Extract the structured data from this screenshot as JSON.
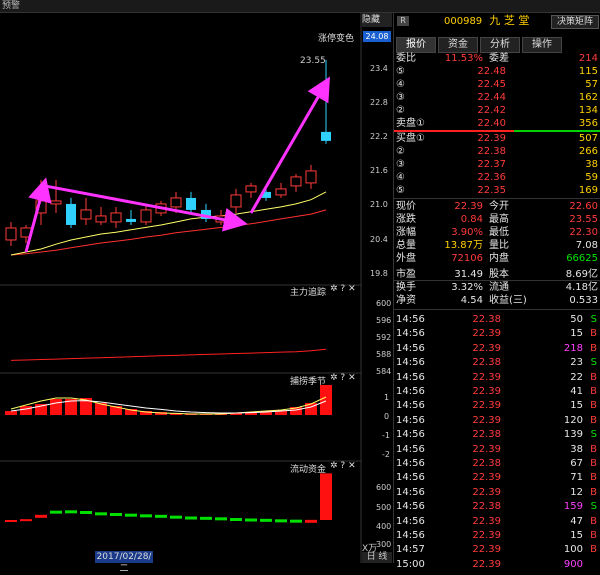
{
  "window": {
    "title": "预警"
  },
  "header": {
    "badge": "R",
    "code": "000989",
    "name": "九 芝 堂",
    "decision_button": "决策矩阵",
    "hide_button": "隐藏",
    "collapse_icon": "double-chevron-right-icon"
  },
  "tabs": [
    {
      "label": "报价",
      "active": true
    },
    {
      "label": "资金",
      "active": false
    },
    {
      "label": "分析",
      "active": false
    },
    {
      "label": "操作",
      "active": false
    }
  ],
  "main_chart": {
    "title": "涨停变色",
    "price_high_label": "23.55",
    "price_axis": [
      "24.08",
      "23.4",
      "22.8",
      "22.2",
      "21.6",
      "21.0",
      "20.4",
      "19.8"
    ],
    "current_marker": "24.08"
  },
  "indicators": [
    {
      "title": "主力追踪",
      "axis": [
        "600",
        "596",
        "592",
        "588",
        "584"
      ]
    },
    {
      "title": "捕捞季节",
      "axis": [
        "1",
        "0",
        "-1",
        "-2"
      ]
    },
    {
      "title": "流动资金",
      "axis": [
        "600",
        "500",
        "400",
        "300"
      ]
    }
  ],
  "footer": {
    "date_label": "2017/02/28/二",
    "unit_label": "X万",
    "period_label": "日 线"
  },
  "quote": {
    "ratio": {
      "label": "委比",
      "value": "11.53%",
      "label2": "委差",
      "value2": "214"
    },
    "asks": [
      {
        "label": "⑤",
        "price": "22.48",
        "vol": "115"
      },
      {
        "label": "④",
        "price": "22.45",
        "vol": "57"
      },
      {
        "label": "③",
        "price": "22.44",
        "vol": "162"
      },
      {
        "label": "②",
        "price": "22.42",
        "vol": "134"
      },
      {
        "label": "卖盘①",
        "price": "22.40",
        "vol": "356"
      }
    ],
    "bids": [
      {
        "label": "买盘①",
        "price": "22.39",
        "vol": "507"
      },
      {
        "label": "②",
        "price": "22.38",
        "vol": "266"
      },
      {
        "label": "③",
        "price": "22.37",
        "vol": "38"
      },
      {
        "label": "④",
        "price": "22.36",
        "vol": "59"
      },
      {
        "label": "⑤",
        "price": "22.35",
        "vol": "169"
      }
    ],
    "stats": [
      {
        "l1": "现价",
        "v1": "22.39",
        "c1": "red",
        "l2": "今开",
        "v2": "22.60",
        "c2": "red"
      },
      {
        "l1": "涨跌",
        "v1": "0.84",
        "c1": "red",
        "l2": "最高",
        "v2": "23.55",
        "c2": "red"
      },
      {
        "l1": "涨幅",
        "v1": "3.90%",
        "c1": "red",
        "l2": "最低",
        "v2": "22.30",
        "c2": "red"
      },
      {
        "l1": "总量",
        "v1": "13.87万",
        "c1": "yellow",
        "l2": "量比",
        "v2": "7.08",
        "c2": "white"
      },
      {
        "l1": "外盘",
        "v1": "72106",
        "c1": "red",
        "l2": "内盘",
        "v2": "66625",
        "c2": "green"
      },
      {
        "l1": "市盈",
        "v1": "31.49",
        "c1": "white",
        "l2": "股本",
        "v2": "8.69亿",
        "c2": "white"
      },
      {
        "l1": "换手",
        "v1": "3.32%",
        "c1": "white",
        "l2": "流通",
        "v2": "4.18亿",
        "c2": "white"
      },
      {
        "l1": "净资",
        "v1": "4.54",
        "c1": "white",
        "l2": "收益(三)",
        "v2": "0.533",
        "c2": "white"
      }
    ],
    "ticks": [
      {
        "time": "14:56",
        "price": "22.38",
        "vol": "50",
        "side": "S",
        "vc": "white"
      },
      {
        "time": "14:56",
        "price": "22.39",
        "vol": "15",
        "side": "B",
        "vc": "white"
      },
      {
        "time": "14:56",
        "price": "22.39",
        "vol": "218",
        "side": "B",
        "vc": "magenta"
      },
      {
        "time": "14:56",
        "price": "22.38",
        "vol": "23",
        "side": "S",
        "vc": "white"
      },
      {
        "time": "14:56",
        "price": "22.39",
        "vol": "22",
        "side": "B",
        "vc": "white"
      },
      {
        "time": "14:56",
        "price": "22.39",
        "vol": "41",
        "side": "B",
        "vc": "white"
      },
      {
        "time": "14:56",
        "price": "22.39",
        "vol": "15",
        "side": "B",
        "vc": "white"
      },
      {
        "time": "14:56",
        "price": "22.39",
        "vol": "120",
        "side": "B",
        "vc": "white"
      },
      {
        "time": "14:56",
        "price": "22.38",
        "vol": "139",
        "side": "S",
        "vc": "white"
      },
      {
        "time": "14:56",
        "price": "22.39",
        "vol": "38",
        "side": "B",
        "vc": "white"
      },
      {
        "time": "14:56",
        "price": "22.38",
        "vol": "67",
        "side": "B",
        "vc": "white"
      },
      {
        "time": "14:56",
        "price": "22.39",
        "vol": "71",
        "side": "B",
        "vc": "white"
      },
      {
        "time": "14:56",
        "price": "22.39",
        "vol": "12",
        "side": "B",
        "vc": "white"
      },
      {
        "time": "14:56",
        "price": "22.38",
        "vol": "159",
        "side": "S",
        "vc": "magenta"
      },
      {
        "time": "14:56",
        "price": "22.39",
        "vol": "47",
        "side": "B",
        "vc": "white"
      },
      {
        "time": "14:56",
        "price": "22.39",
        "vol": "15",
        "side": "B",
        "vc": "white"
      },
      {
        "time": "14:57",
        "price": "22.39",
        "vol": "100",
        "side": "B",
        "vc": "white"
      },
      {
        "time": "15:00",
        "price": "22.39",
        "vol": "900",
        "side": "",
        "vc": "magenta"
      }
    ]
  },
  "colors": {
    "up": "#ff3b3b",
    "down": "#30d0ff",
    "arrow": "#ff33ff",
    "ma1": "#ffff66",
    "ma2": "#ff3030"
  },
  "chart_data": [
    {
      "type": "candlestick",
      "title": "涨停变色",
      "ylim": [
        19.8,
        24.08
      ],
      "candles": [
        {
          "o": 20.55,
          "c": 20.75,
          "h": 20.85,
          "l": 20.45,
          "up": true
        },
        {
          "o": 20.6,
          "c": 20.75,
          "h": 20.8,
          "l": 20.5,
          "up": true
        },
        {
          "o": 21.0,
          "c": 21.2,
          "h": 21.55,
          "l": 20.8,
          "up": true
        },
        {
          "o": 21.2,
          "c": 21.15,
          "h": 21.55,
          "l": 21.0,
          "up": true
        },
        {
          "o": 21.15,
          "c": 20.8,
          "h": 21.25,
          "l": 20.75,
          "up": false
        },
        {
          "o": 20.9,
          "c": 21.05,
          "h": 21.25,
          "l": 20.8,
          "up": true
        },
        {
          "o": 20.95,
          "c": 20.85,
          "h": 21.1,
          "l": 20.8,
          "up": true
        },
        {
          "o": 20.85,
          "c": 21.0,
          "h": 21.1,
          "l": 20.75,
          "up": true
        },
        {
          "o": 20.9,
          "c": 20.85,
          "h": 21.05,
          "l": 20.8,
          "up": false
        },
        {
          "o": 20.85,
          "c": 21.05,
          "h": 21.15,
          "l": 20.8,
          "up": true
        },
        {
          "o": 21.0,
          "c": 21.15,
          "h": 21.2,
          "l": 20.95,
          "up": true
        },
        {
          "o": 21.25,
          "c": 21.1,
          "h": 21.35,
          "l": 21.0,
          "up": true
        },
        {
          "o": 21.25,
          "c": 21.05,
          "h": 21.35,
          "l": 21.0,
          "up": false
        },
        {
          "o": 21.05,
          "c": 20.9,
          "h": 21.15,
          "l": 20.85,
          "up": false
        },
        {
          "o": 20.95,
          "c": 20.85,
          "h": 21.05,
          "l": 20.8,
          "up": true
        },
        {
          "o": 21.1,
          "c": 21.3,
          "h": 21.4,
          "l": 21.0,
          "up": true
        },
        {
          "o": 21.35,
          "c": 21.45,
          "h": 21.5,
          "l": 21.25,
          "up": true
        },
        {
          "o": 21.35,
          "c": 21.25,
          "h": 21.4,
          "l": 21.2,
          "up": false
        },
        {
          "o": 21.3,
          "c": 21.4,
          "h": 21.5,
          "l": 21.25,
          "up": true
        },
        {
          "o": 21.45,
          "c": 21.6,
          "h": 21.65,
          "l": 21.35,
          "up": true
        },
        {
          "o": 21.5,
          "c": 21.7,
          "h": 21.8,
          "l": 21.4,
          "up": true
        },
        {
          "o": 22.35,
          "c": 22.2,
          "h": 23.55,
          "l": 22.15,
          "up": false
        }
      ],
      "ma_short": [
        20.3,
        20.35,
        20.4,
        20.48,
        20.55,
        20.6,
        20.65,
        20.68,
        20.72,
        20.76,
        20.8,
        20.85,
        20.9,
        20.93,
        20.95,
        20.98,
        21.02,
        21.06,
        21.1,
        21.15,
        21.22,
        21.35
      ],
      "ma_long": [
        20.3,
        20.32,
        20.35,
        20.38,
        20.42,
        20.46,
        20.5,
        20.53,
        20.56,
        20.6,
        20.63,
        20.67,
        20.7,
        20.73,
        20.76,
        20.79,
        20.82,
        20.86,
        20.9,
        20.94,
        20.98,
        21.05
      ]
    },
    {
      "type": "line",
      "title": "主力追踪",
      "ylim": [
        584,
        600
      ],
      "values": [
        585.2,
        585.3,
        585.4,
        585.5,
        585.6,
        585.7,
        585.8,
        585.9,
        586.0,
        586.1,
        586.2,
        586.3,
        586.4,
        586.5,
        586.6,
        586.7,
        586.8,
        586.9,
        587.0,
        587.1,
        587.3,
        587.6
      ]
    },
    {
      "type": "bar",
      "title": "捕捞季节",
      "ylim": [
        -2,
        1.5
      ],
      "values": [
        0.2,
        0.45,
        0.55,
        0.8,
        0.8,
        0.85,
        0.6,
        0.45,
        0.3,
        0.2,
        0.15,
        0.1,
        0.08,
        0.05,
        0.05,
        0.1,
        0.12,
        0.2,
        0.25,
        0.4,
        0.6,
        1.5
      ],
      "line_a": [
        0.3,
        0.5,
        0.7,
        0.85,
        0.85,
        0.75,
        0.55,
        0.4,
        0.25,
        0.15,
        0.1,
        0.08,
        0.05,
        0.05,
        0.05,
        0.1,
        0.15,
        0.2,
        0.25,
        0.35,
        0.55,
        0.9
      ],
      "line_b": [
        0.2,
        0.3,
        0.45,
        0.6,
        0.7,
        0.72,
        0.65,
        0.55,
        0.45,
        0.35,
        0.28,
        0.2,
        0.15,
        0.12,
        0.1,
        0.1,
        0.12,
        0.15,
        0.2,
        0.25,
        0.4,
        0.7
      ]
    },
    {
      "type": "bar",
      "title": "流动资金",
      "ylim": [
        250,
        700
      ],
      "baseline": 400,
      "values": [
        395,
        405,
        425,
        450,
        452,
        448,
        440,
        436,
        432,
        428,
        425,
        420,
        415,
        413,
        410,
        406,
        403,
        401,
        398,
        396,
        395,
        680
      ],
      "up": [
        true,
        true,
        true,
        false,
        false,
        false,
        false,
        false,
        false,
        false,
        false,
        false,
        false,
        false,
        false,
        false,
        false,
        false,
        false,
        false,
        true,
        true
      ]
    }
  ]
}
